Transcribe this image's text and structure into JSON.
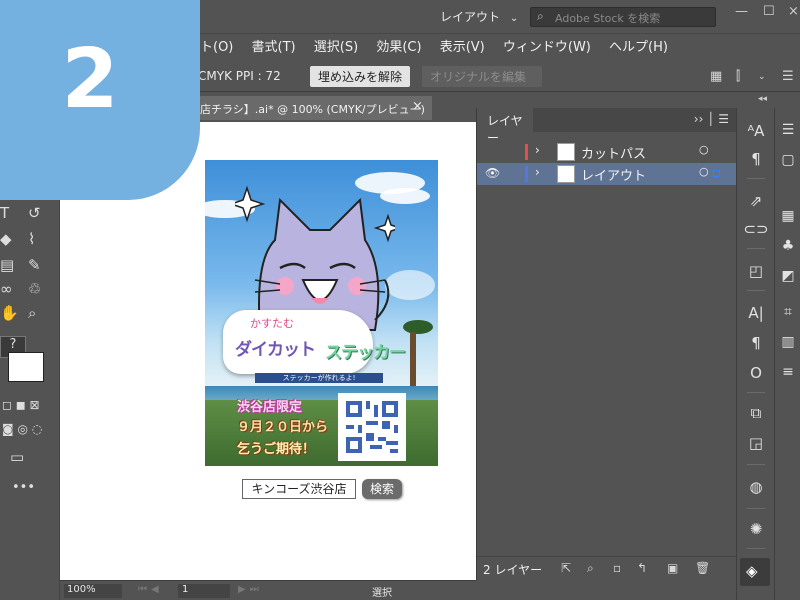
{
  "menubar": {
    "workspace": "レイアウト",
    "search_placeholder": "Adobe Stock を検索",
    "items": [
      "ト(O)",
      "書式(T)",
      "選択(S)",
      "効果(C)",
      "表示(V)",
      "ウィンドウ(W)",
      "ヘルプ(H)"
    ]
  },
  "controlbar": {
    "color_info": "CMYK  PPI : 72",
    "embed_label": "埋め込みを解除",
    "edit_label": "オリジナルを編集"
  },
  "document": {
    "tab_title": "店チラシ】.ai* @ 100% (CMYK/プレビュー)",
    "close": "×"
  },
  "badge": {
    "number": "2"
  },
  "flyer": {
    "subtitle": "かすたむ",
    "title_a": "ダイカット",
    "title_b": "ステッカー",
    "banner": "ステッカーが作れるよ!",
    "line1": "渋谷店限定",
    "line2": "９月２０日から",
    "line3": "乞うご期待！"
  },
  "search": {
    "query": "キンコーズ渋谷店",
    "button": "検索"
  },
  "statusbar": {
    "zoom": "100%",
    "page": "1",
    "tool": "選択"
  },
  "layers": {
    "tab": "レイヤー",
    "rows": [
      {
        "name": "カットパス",
        "color": "#e05050",
        "visible": false,
        "selected": false
      },
      {
        "name": "レイアウト",
        "color": "#5577dd",
        "visible": true,
        "selected": true
      }
    ],
    "count": "2 レイヤー"
  },
  "colors": {
    "badge": "#74b0e0",
    "selected_row": "#5f7394",
    "panel_bg": "#535353"
  }
}
